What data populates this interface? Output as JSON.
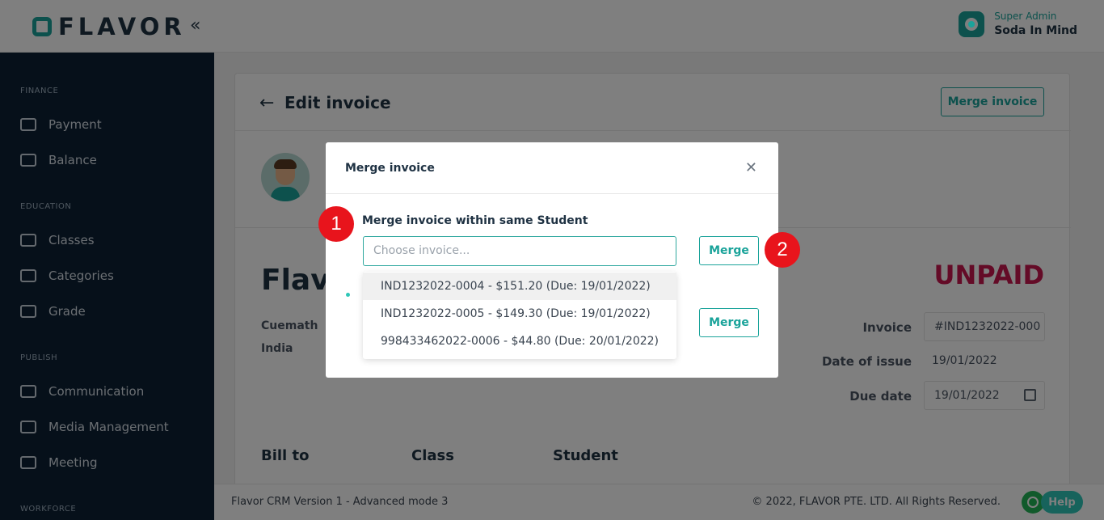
{
  "header": {
    "logo_text": "FLAVOR",
    "collapse_icon": "double-chevron-left-icon",
    "user": {
      "role": "Super Admin",
      "name": "Soda In Mind"
    }
  },
  "sidebar": {
    "sections": [
      {
        "title": "FINANCE",
        "items": [
          {
            "label": "Payment",
            "icon": "card-icon"
          },
          {
            "label": "Balance",
            "icon": "ledger-icon"
          }
        ]
      },
      {
        "title": "EDUCATION",
        "items": [
          {
            "label": "Classes",
            "icon": "book-icon"
          },
          {
            "label": "Categories",
            "icon": "layers-icon"
          },
          {
            "label": "Grade",
            "icon": "grade-icon"
          }
        ]
      },
      {
        "title": "PUBLISH",
        "items": [
          {
            "label": "Communication",
            "icon": "chat-icon"
          },
          {
            "label": "Media Management",
            "icon": "image-icon"
          },
          {
            "label": "Meeting",
            "icon": "podium-icon"
          }
        ]
      },
      {
        "title": "WORKFORCE",
        "items": []
      }
    ]
  },
  "main": {
    "title": "Edit invoice",
    "merge_button": "Merge invoice",
    "company_name": "Flavo",
    "status": "UNPAID",
    "address": [
      "Cuemath",
      "India"
    ],
    "fields": {
      "invoice_label": "Invoice",
      "invoice_value": "#IND1232022-000",
      "date_issue_label": "Date of issue",
      "date_issue_value": "19/01/2022",
      "due_date_label": "Due date",
      "due_date_value": "19/01/2022"
    },
    "columns": [
      "Bill to",
      "Class",
      "Student"
    ]
  },
  "modal": {
    "title": "Merge invoice",
    "close_icon": "close-icon",
    "section_label": "Merge invoice within same Student",
    "select_placeholder": "Choose invoice...",
    "merge_label": "Merge",
    "options": [
      "IND1232022-0004 -  $151.20  (Due: 19/01/2022)",
      "IND1232022-0005 -  $149.30  (Due: 19/01/2022)",
      "998433462022-0006 -  $44.80  (Due: 20/01/2022)"
    ]
  },
  "steps": [
    "1",
    "2"
  ],
  "footer": {
    "version": "Flavor CRM Version 1 - Advanced mode 3",
    "copyright": "© 2022, FLAVOR PTE. LTD. All Rights Reserved.",
    "help": "Help"
  },
  "colors": {
    "accent": "#1aa39a",
    "sidebar": "#0d2035",
    "unpaid": "#c8174f",
    "step": "#e8141c"
  }
}
